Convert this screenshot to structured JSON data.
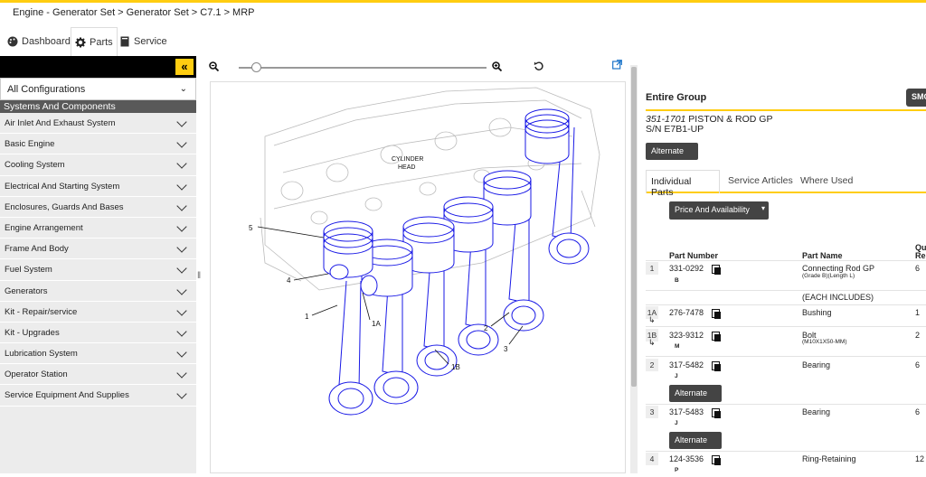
{
  "breadcrumb": "Engine - Generator Set > Generator Set > C7.1 > MRP",
  "tabs": [
    {
      "label": "Dashboard",
      "icon": "palette-icon"
    },
    {
      "label": "Parts",
      "icon": "gear-icon"
    },
    {
      "label": "Service",
      "icon": "book-icon"
    }
  ],
  "sidebar": {
    "collapse_icon": "«",
    "config_select": "All Configurations",
    "section_title": "Systems And Components",
    "items": [
      "Air Inlet And Exhaust System",
      "Basic Engine",
      "Cooling System",
      "Electrical And Starting System",
      "Enclosures, Guards And Bases",
      "Engine Arrangement",
      "Frame And Body",
      "Fuel System",
      "Generators",
      "Kit - Repair/service",
      "Kit - Upgrades",
      "Lubrication System",
      "Operator Station",
      "Service Equipment And Supplies"
    ]
  },
  "viewer": {
    "zoom_level": 0.07,
    "diagram_labels": {
      "cylinder_head_1": "CYLINDER",
      "cylinder_head_2": "HEAD",
      "c5": "5",
      "c4": "4",
      "c1": "1",
      "c1a": "1A",
      "c1b": "1B",
      "c2": "2",
      "c3": "3"
    }
  },
  "panel": {
    "group_title": "Entire Group",
    "smc_label": "SMC",
    "part_number_italic": "351-1701",
    "part_title": " PISTON & ROD GP",
    "serial": "S/N E7B1-UP",
    "alternate_label": "Alternate",
    "tabs": [
      "Individual Parts",
      "Service Articles",
      "Where Used"
    ],
    "price_button": "Price And Availability",
    "columns": {
      "part_number": "Part Number",
      "part_name": "Part Name",
      "qty_1": "Qu",
      "qty_2": "Re"
    },
    "rows": [
      {
        "idx": "1",
        "pn": "331-0292",
        "code": "B",
        "name": "Connecting Rod GP",
        "detail": "(Grade B)(Length L)",
        "qty": "6"
      },
      {
        "idx": "",
        "pn": "",
        "code": "",
        "name": "(EACH INCLUDES)",
        "detail": "",
        "qty": ""
      },
      {
        "idx": "1A",
        "pn": "276-7478",
        "code": "",
        "name": "Bushing",
        "detail": "",
        "qty": "1"
      },
      {
        "idx": "1B",
        "pn": "323-9312",
        "code": "M",
        "name": "Bolt",
        "detail": "(M10X1X50-MM)",
        "qty": "2"
      },
      {
        "idx": "2",
        "pn": "317-5482",
        "code": "J",
        "name": "Bearing",
        "detail": "",
        "qty": "6"
      },
      {
        "idx": "3",
        "pn": "317-5483",
        "code": "J",
        "name": "Bearing",
        "detail": "",
        "qty": "6"
      },
      {
        "idx": "4",
        "pn": "124-3536",
        "code": "P",
        "name": "Ring-Retaining",
        "detail": "",
        "qty": "12"
      }
    ]
  }
}
